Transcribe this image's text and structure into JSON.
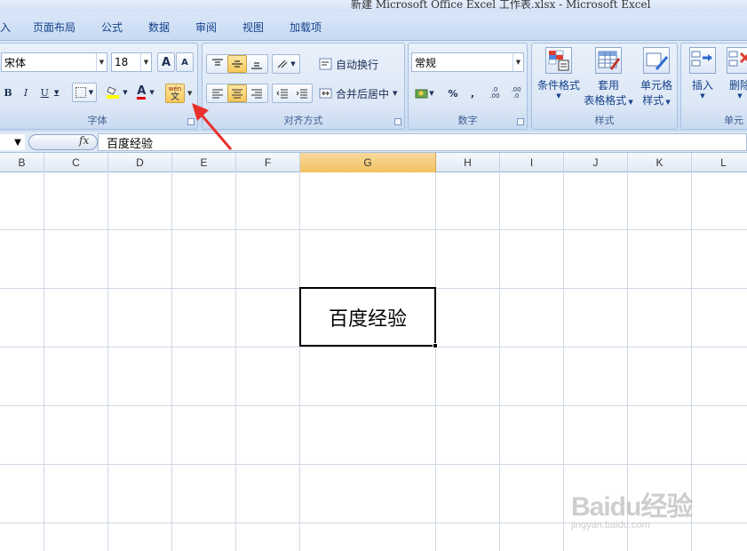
{
  "window": {
    "title": "新建 Microsoft Office Excel 工作表.xlsx - Microsoft Excel"
  },
  "menu": {
    "tabs": [
      "入",
      "页面布局",
      "公式",
      "数据",
      "审阅",
      "视图",
      "加载项"
    ]
  },
  "ribbon": {
    "font_group": {
      "label": "字体",
      "font_name": "宋体",
      "font_size": "18",
      "bold": "B",
      "italic": "I",
      "underline": "U",
      "grow": "A",
      "shrink": "A",
      "font_color_letter": "A",
      "phonetic_top": "wén",
      "phonetic_bottom": "文"
    },
    "align_group": {
      "label": "对齐方式",
      "wrap": "自动换行",
      "merge": "合并后居中"
    },
    "number_group": {
      "label": "数字",
      "format": "常规",
      "percent": "%",
      "comma": ",",
      "inc_decimal": ".0 .00",
      "dec_decimal": ".00 .0"
    },
    "styles_group": {
      "label": "样式",
      "conditional": "条件格式",
      "table_line1": "套用",
      "table_line2": "表格格式",
      "cell_line1": "单元格",
      "cell_line2": "样式"
    },
    "cells_group": {
      "label": "单元",
      "insert": "插入",
      "delete": "删除"
    }
  },
  "formula_bar": {
    "fx": "fx",
    "value": "百度经验"
  },
  "columns": [
    "B",
    "C",
    "D",
    "E",
    "F",
    "G",
    "H",
    "I",
    "J",
    "K",
    "L"
  ],
  "selected_column": "G",
  "active_cell": {
    "value": "百度经验"
  },
  "watermark": {
    "main": "Baidu经验",
    "sub": "jingyan.baidu.com"
  },
  "colors": {
    "accent": "#f1c15f",
    "annotation_arrow": "#e8302c"
  }
}
